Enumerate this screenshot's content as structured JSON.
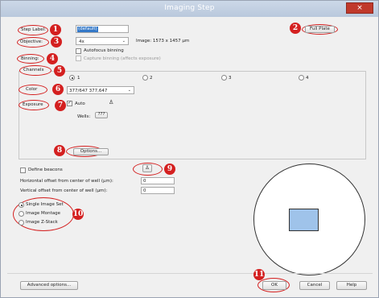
{
  "window": {
    "title": "Imaging Step",
    "close": "×"
  },
  "step_label": {
    "label": "Step Label:",
    "value": "(default)"
  },
  "full_plate_button": "Full Plate",
  "objective": {
    "label": "Objective:",
    "value": "4x",
    "image_info": "Image: 1573 x 1457 µm"
  },
  "autofocus_binning": {
    "label": "Autofocus binning",
    "checked": false
  },
  "binning": {
    "label": "Binning:",
    "capture_label": "Capture binning (affects exposure)",
    "checked": false
  },
  "channels": {
    "label": "Channels",
    "tabs": [
      "1",
      "2",
      "3",
      "4"
    ],
    "selected": "1"
  },
  "color": {
    "label": "Color",
    "value": "377/647 377,647"
  },
  "exposure": {
    "label": "Exposure",
    "auto_label": "Auto",
    "auto_checked": true,
    "wells_label": "Wells:",
    "wells_button": "???"
  },
  "options_button": "Options...",
  "define_beacons": {
    "label": "Define beacons",
    "checked": false
  },
  "offsets": {
    "horizontal_label": "Horizontal offset from center of well (µm):",
    "horizontal_value": "0",
    "vertical_label": "Vertical offset from center of well (µm):",
    "vertical_value": "0"
  },
  "acquisition_modes": [
    {
      "label": "Single Image Set",
      "selected": true
    },
    {
      "label": "Image Montage",
      "selected": false
    },
    {
      "label": "Image Z-Stack",
      "selected": false
    }
  ],
  "footer": {
    "advanced": "Advanced options...",
    "ok": "OK",
    "cancel": "Cancel",
    "help": "Help"
  },
  "annotations": [
    "1",
    "2",
    "3",
    "4",
    "5",
    "6",
    "7",
    "8",
    "9",
    "10",
    "11"
  ],
  "colors": {
    "annotation": "#d42020",
    "titlebar": "#b9c8dc",
    "preview_fill": "#9fc3ea"
  }
}
